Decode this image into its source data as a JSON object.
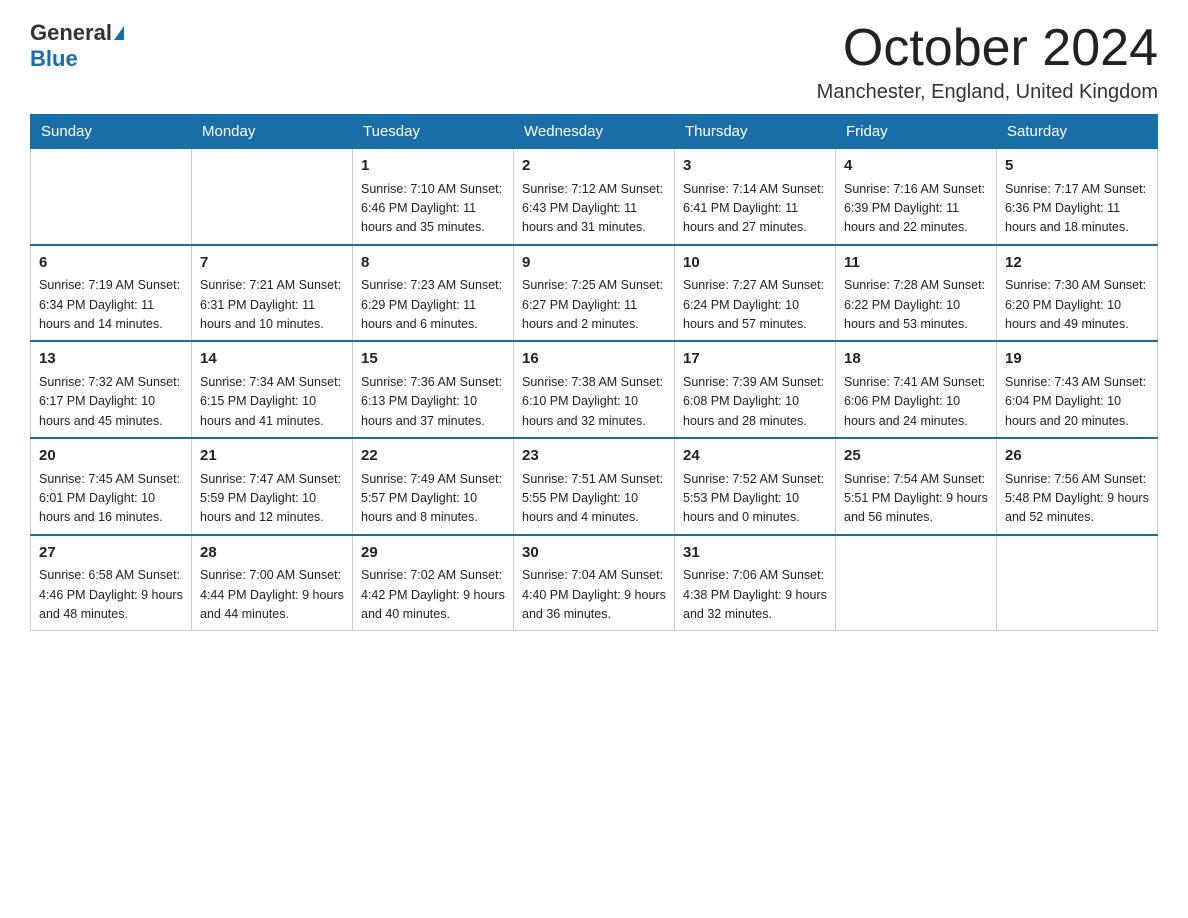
{
  "logo": {
    "general": "General",
    "blue": "Blue"
  },
  "title": {
    "month": "October 2024",
    "location": "Manchester, England, United Kingdom"
  },
  "days_of_week": [
    "Sunday",
    "Monday",
    "Tuesday",
    "Wednesday",
    "Thursday",
    "Friday",
    "Saturday"
  ],
  "weeks": [
    [
      {
        "day": "",
        "info": ""
      },
      {
        "day": "",
        "info": ""
      },
      {
        "day": "1",
        "info": "Sunrise: 7:10 AM\nSunset: 6:46 PM\nDaylight: 11 hours\nand 35 minutes."
      },
      {
        "day": "2",
        "info": "Sunrise: 7:12 AM\nSunset: 6:43 PM\nDaylight: 11 hours\nand 31 minutes."
      },
      {
        "day": "3",
        "info": "Sunrise: 7:14 AM\nSunset: 6:41 PM\nDaylight: 11 hours\nand 27 minutes."
      },
      {
        "day": "4",
        "info": "Sunrise: 7:16 AM\nSunset: 6:39 PM\nDaylight: 11 hours\nand 22 minutes."
      },
      {
        "day": "5",
        "info": "Sunrise: 7:17 AM\nSunset: 6:36 PM\nDaylight: 11 hours\nand 18 minutes."
      }
    ],
    [
      {
        "day": "6",
        "info": "Sunrise: 7:19 AM\nSunset: 6:34 PM\nDaylight: 11 hours\nand 14 minutes."
      },
      {
        "day": "7",
        "info": "Sunrise: 7:21 AM\nSunset: 6:31 PM\nDaylight: 11 hours\nand 10 minutes."
      },
      {
        "day": "8",
        "info": "Sunrise: 7:23 AM\nSunset: 6:29 PM\nDaylight: 11 hours\nand 6 minutes."
      },
      {
        "day": "9",
        "info": "Sunrise: 7:25 AM\nSunset: 6:27 PM\nDaylight: 11 hours\nand 2 minutes."
      },
      {
        "day": "10",
        "info": "Sunrise: 7:27 AM\nSunset: 6:24 PM\nDaylight: 10 hours\nand 57 minutes."
      },
      {
        "day": "11",
        "info": "Sunrise: 7:28 AM\nSunset: 6:22 PM\nDaylight: 10 hours\nand 53 minutes."
      },
      {
        "day": "12",
        "info": "Sunrise: 7:30 AM\nSunset: 6:20 PM\nDaylight: 10 hours\nand 49 minutes."
      }
    ],
    [
      {
        "day": "13",
        "info": "Sunrise: 7:32 AM\nSunset: 6:17 PM\nDaylight: 10 hours\nand 45 minutes."
      },
      {
        "day": "14",
        "info": "Sunrise: 7:34 AM\nSunset: 6:15 PM\nDaylight: 10 hours\nand 41 minutes."
      },
      {
        "day": "15",
        "info": "Sunrise: 7:36 AM\nSunset: 6:13 PM\nDaylight: 10 hours\nand 37 minutes."
      },
      {
        "day": "16",
        "info": "Sunrise: 7:38 AM\nSunset: 6:10 PM\nDaylight: 10 hours\nand 32 minutes."
      },
      {
        "day": "17",
        "info": "Sunrise: 7:39 AM\nSunset: 6:08 PM\nDaylight: 10 hours\nand 28 minutes."
      },
      {
        "day": "18",
        "info": "Sunrise: 7:41 AM\nSunset: 6:06 PM\nDaylight: 10 hours\nand 24 minutes."
      },
      {
        "day": "19",
        "info": "Sunrise: 7:43 AM\nSunset: 6:04 PM\nDaylight: 10 hours\nand 20 minutes."
      }
    ],
    [
      {
        "day": "20",
        "info": "Sunrise: 7:45 AM\nSunset: 6:01 PM\nDaylight: 10 hours\nand 16 minutes."
      },
      {
        "day": "21",
        "info": "Sunrise: 7:47 AM\nSunset: 5:59 PM\nDaylight: 10 hours\nand 12 minutes."
      },
      {
        "day": "22",
        "info": "Sunrise: 7:49 AM\nSunset: 5:57 PM\nDaylight: 10 hours\nand 8 minutes."
      },
      {
        "day": "23",
        "info": "Sunrise: 7:51 AM\nSunset: 5:55 PM\nDaylight: 10 hours\nand 4 minutes."
      },
      {
        "day": "24",
        "info": "Sunrise: 7:52 AM\nSunset: 5:53 PM\nDaylight: 10 hours\nand 0 minutes."
      },
      {
        "day": "25",
        "info": "Sunrise: 7:54 AM\nSunset: 5:51 PM\nDaylight: 9 hours\nand 56 minutes."
      },
      {
        "day": "26",
        "info": "Sunrise: 7:56 AM\nSunset: 5:48 PM\nDaylight: 9 hours\nand 52 minutes."
      }
    ],
    [
      {
        "day": "27",
        "info": "Sunrise: 6:58 AM\nSunset: 4:46 PM\nDaylight: 9 hours\nand 48 minutes."
      },
      {
        "day": "28",
        "info": "Sunrise: 7:00 AM\nSunset: 4:44 PM\nDaylight: 9 hours\nand 44 minutes."
      },
      {
        "day": "29",
        "info": "Sunrise: 7:02 AM\nSunset: 4:42 PM\nDaylight: 9 hours\nand 40 minutes."
      },
      {
        "day": "30",
        "info": "Sunrise: 7:04 AM\nSunset: 4:40 PM\nDaylight: 9 hours\nand 36 minutes."
      },
      {
        "day": "31",
        "info": "Sunrise: 7:06 AM\nSunset: 4:38 PM\nDaylight: 9 hours\nand 32 minutes."
      },
      {
        "day": "",
        "info": ""
      },
      {
        "day": "",
        "info": ""
      }
    ]
  ]
}
